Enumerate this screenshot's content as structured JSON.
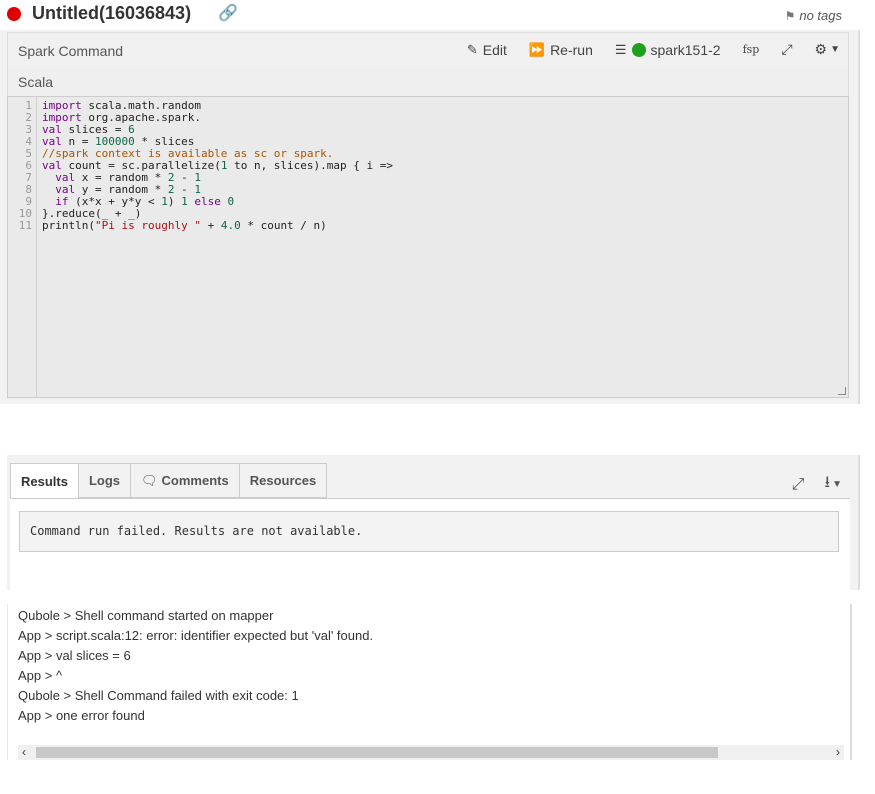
{
  "header": {
    "title": "Untitled(16036843)",
    "tags": "no tags",
    "status_color": "#e00000"
  },
  "command": {
    "title": "Spark Command",
    "edit_label": "Edit",
    "rerun_label": "Re-run",
    "cluster_label": "spark151-2",
    "cluster_status_color": "#1ea01e",
    "fsp_label": "fsp",
    "language": "Scala"
  },
  "code": {
    "line_numbers": [
      "1",
      "2",
      "3",
      "4",
      "5",
      "6",
      "7",
      "8",
      "9",
      "10",
      "11"
    ],
    "lines": [
      "import scala.math.random",
      "import org.apache.spark.",
      "val slices = 6",
      "val n = 100000 * slices",
      "//spark context is available as sc or spark.",
      "val count = sc.parallelize(1 to n, slices).map { i =>",
      "  val x = random * 2 - 1",
      "  val y = random * 2 - 1",
      "  if (x*x + y*y < 1) 1 else 0",
      "}.reduce(_ + _)",
      "println(\"Pi is roughly \" + 4.0 * count / n)"
    ]
  },
  "results": {
    "tabs": [
      "Results",
      "Logs",
      "Comments",
      "Resources"
    ],
    "message": "Command run failed. Results are not available."
  },
  "logs": {
    "lines": [
      "Qubole > Shell command started on mapper",
      "App > script.scala:12: error: identifier expected but 'val' found.",
      "App > val slices = 6",
      "App > ^",
      "Qubole > Shell Command failed with exit code: 1",
      "App > one error found"
    ]
  }
}
